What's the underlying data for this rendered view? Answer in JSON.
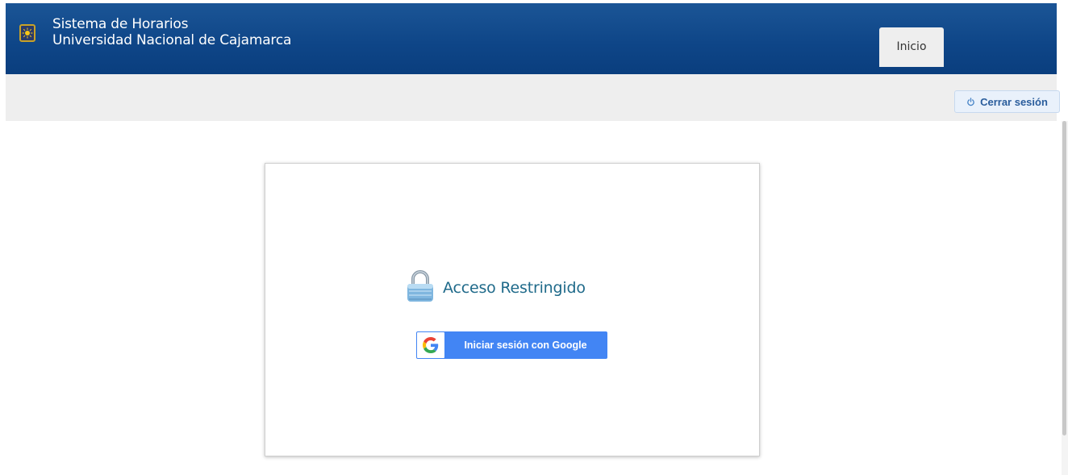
{
  "header": {
    "brand_line1": "Sistema de Horarios",
    "brand_line2": "Universidad Nacional de Cajamarca",
    "tab_label": "Inicio"
  },
  "toolbar": {
    "logout_label": "Cerrar sesión",
    "logout_icon": "power-icon"
  },
  "login_card": {
    "title": "Acceso Restringido",
    "title_icon": "lock-icon",
    "google_button_label": "Iniciar sesión con Google",
    "google_icon": "google-g-icon"
  },
  "colors": {
    "header_blue": "#0e4587",
    "subbar_gray": "#eeeeee",
    "google_blue": "#4285f4",
    "title_teal": "#1f6a8a"
  }
}
